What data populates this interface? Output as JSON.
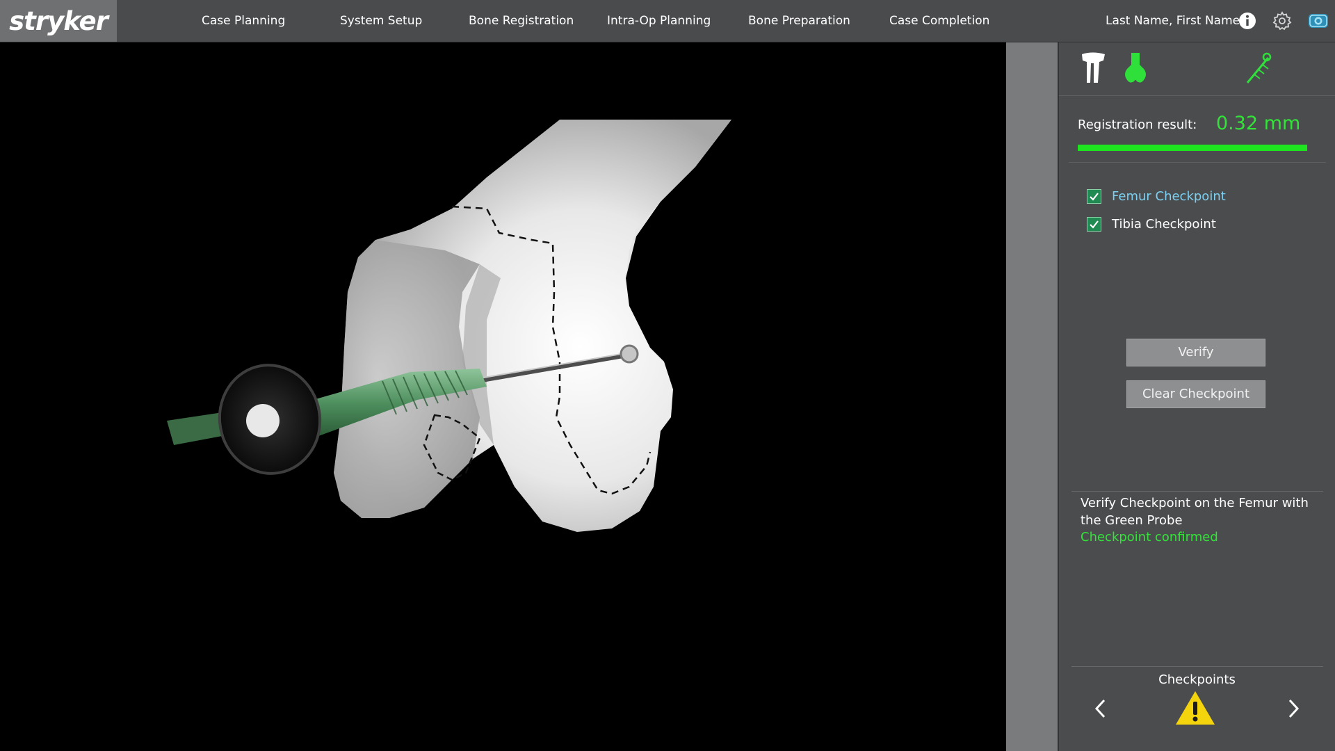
{
  "brand": {
    "logo": "stryker"
  },
  "nav": {
    "items": [
      {
        "label": "Case Planning"
      },
      {
        "label": "System Setup"
      },
      {
        "label": "Bone Registration"
      },
      {
        "label": "Intra-Op Planning"
      },
      {
        "label": "Bone Preparation"
      },
      {
        "label": "Case Completion"
      }
    ],
    "user": "Last Name, First Name",
    "icons": [
      "info-icon",
      "gear-icon",
      "camera-icon"
    ]
  },
  "panel": {
    "icons": [
      "tibia-bone-icon",
      "femur-bone-icon",
      "green-probe-icon"
    ],
    "registration": {
      "label": "Registration result:",
      "value": "0.32 mm",
      "bar_fraction": 1.0
    },
    "checkpoints": [
      {
        "label": "Femur Checkpoint",
        "checked": true,
        "active": true
      },
      {
        "label": "Tibia Checkpoint",
        "checked": true,
        "active": false
      }
    ],
    "buttons": {
      "verify": "Verify",
      "clear": "Clear Checkpoint"
    },
    "instruction": {
      "text": "Verify Checkpoint on the Femur with the Green Probe",
      "status": "Checkpoint confirmed"
    },
    "footer": {
      "title": "Checkpoints",
      "status_icon": "warning-icon"
    }
  },
  "colors": {
    "accent_green": "#34e33a",
    "active_label": "#7cd0f2",
    "checkbox": "#1f8a52",
    "topbar": "#4a4b4d",
    "panel": "#4b4c4e",
    "warning": "#f4d40c"
  }
}
